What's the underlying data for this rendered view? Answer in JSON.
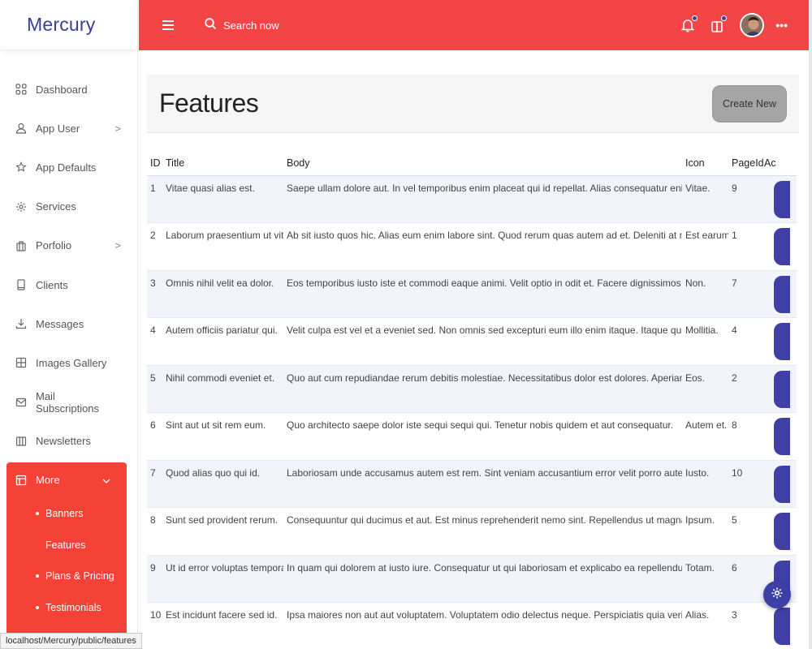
{
  "brand": "Mercury",
  "header": {
    "search_placeholder": "Search now",
    "more_dots": "•••"
  },
  "sidebar": {
    "items": [
      {
        "label": "Dashboard",
        "icon": "grid-icon",
        "chevron": ""
      },
      {
        "label": "App User",
        "icon": "user-icon",
        "chevron": ">"
      },
      {
        "label": "App Defaults",
        "icon": "star-icon",
        "chevron": ""
      },
      {
        "label": "Services",
        "icon": "gear-icon",
        "chevron": ""
      },
      {
        "label": "Porfolio",
        "icon": "briefcase-icon",
        "chevron": ">"
      },
      {
        "label": "Clients",
        "icon": "tablet-icon",
        "chevron": ""
      },
      {
        "label": "Messages",
        "icon": "download-icon",
        "chevron": ""
      },
      {
        "label": "Images Gallery",
        "icon": "gallery-icon",
        "chevron": ""
      },
      {
        "label": "Mail Subscriptions",
        "icon": "mail-icon",
        "chevron": ""
      },
      {
        "label": "Newsletters",
        "icon": "columns-icon",
        "chevron": ""
      }
    ],
    "more": {
      "label": "More",
      "chevron": "v",
      "sub_items": [
        {
          "label": "Banners",
          "active": false
        },
        {
          "label": "Features",
          "active": true
        },
        {
          "label": "Plans & Pricing",
          "active": false
        },
        {
          "label": "Testimonials",
          "active": false
        }
      ]
    }
  },
  "page": {
    "title": "Features",
    "create_button": "Create New"
  },
  "table": {
    "headers": [
      "ID",
      "Title",
      "Body",
      "Icon",
      "PageId",
      "Ac"
    ],
    "rows": [
      [
        "1",
        "Vitae quasi alias est.",
        "Saepe ullam dolore aut. In vel temporibus enim placeat qui id repellat. Alias consequatur enim vero",
        "Vitae.",
        "9"
      ],
      [
        "2",
        "Laborum praesentium ut vitae.",
        "Ab sit iusto quos hic. Alias eum enim labore sint. Quod rerum quas autem ad et. Deleniti at minus ve",
        "Est earum.",
        "1"
      ],
      [
        "3",
        "Omnis nihil velit ea dolor.",
        "Eos temporibus iusto iste et commodi eaque animi. Velit optio in odit et. Facere dignissimos unde ac",
        "Non.",
        "7"
      ],
      [
        "4",
        "Autem officiis pariatur qui.",
        "Velit culpa est vel et a eveniet sed. Non omnis sed excepturi eum illo enim itaque. Itaque qui atque",
        "Mollitia.",
        "4"
      ],
      [
        "5",
        "Nihil commodi eveniet et.",
        "Quo aut cum repudiandae rerum debitis molestiae. Necessitatibus dolor est dolores. Aperiam harum qui",
        "Eos.",
        "2"
      ],
      [
        "6",
        "Sint aut ut sit rem eum.",
        "Quo architecto saepe dolor iste sequi sequi qui. Tenetur nobis quidem et aut consequatur.",
        "Autem et.",
        "8"
      ],
      [
        "7",
        "Quod alias quo qui id.",
        "Laboriosam unde accusamus autem est rem. Sint veniam accusantium error velit porro autem. Non velit",
        "Iusto.",
        "10"
      ],
      [
        "8",
        "Sunt sed provident rerum.",
        "Consequuntur qui ducimus et aut. Est minus reprehenderit nemo sint. Repellendus ut magnam molestias",
        "Ipsum.",
        "5"
      ],
      [
        "9",
        "Ut id error voluptas tempora.",
        "In quam qui dolorem at iusto iure. Consequatur ut qui laboriosam et explicabo ea repellendus. Natus",
        "Totam.",
        "6"
      ],
      [
        "10",
        "Est incidunt facere sed id.",
        "Ipsa maiores non aut aut voluptatem. Voluptatem odio delectus neque. Perspiciatis quia veritatis rer",
        "Alias.",
        "3"
      ]
    ]
  },
  "status_url": "localhost/Mercury/public/features",
  "colors": {
    "accent_red": "#f44546",
    "accent_blue": "#3f3fa6",
    "row_stripe": "#f2f4fc"
  }
}
